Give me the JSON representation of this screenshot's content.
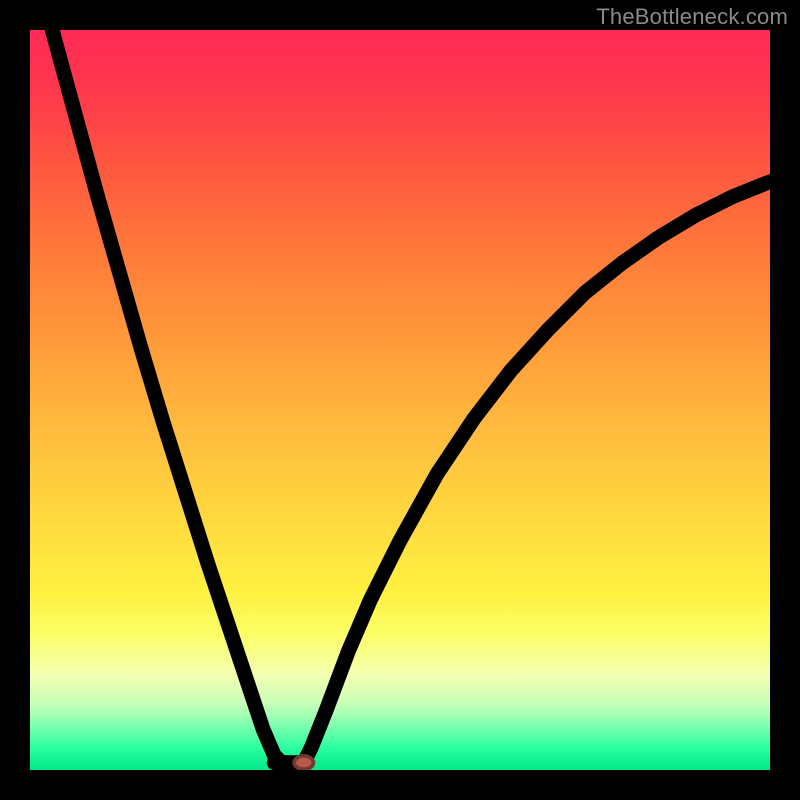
{
  "watermark": "TheBottleneck.com",
  "chart_data": {
    "type": "line",
    "title": "",
    "xlabel": "",
    "ylabel": "",
    "xlim": [
      0,
      100
    ],
    "ylim": [
      0,
      100
    ],
    "background_gradient": {
      "top": "#ff2a55",
      "bottom": "#00e78a",
      "stops": [
        {
          "pct": 0,
          "color": "#ff2a55"
        },
        {
          "pct": 30,
          "color": "#ff7a3a"
        },
        {
          "pct": 66,
          "color": "#ffd93f"
        },
        {
          "pct": 87,
          "color": "#f4ffb0"
        },
        {
          "pct": 100,
          "color": "#00e78a"
        }
      ]
    },
    "series": [
      {
        "name": "left-branch",
        "x": [
          3,
          6,
          9,
          12,
          15,
          18,
          21,
          24,
          27,
          30,
          31.5,
          33,
          34,
          35
        ],
        "y": [
          100,
          89,
          78,
          67.5,
          57,
          47,
          37.5,
          28,
          19,
          10,
          5.5,
          2,
          1,
          1
        ]
      },
      {
        "name": "right-branch",
        "x": [
          37,
          38,
          40,
          43,
          46,
          50,
          55,
          60,
          65,
          70,
          75,
          80,
          85,
          90,
          95,
          100
        ],
        "y": [
          1,
          3,
          8,
          16,
          23,
          31,
          40,
          47.5,
          54,
          59.5,
          64.5,
          68.5,
          72,
          75,
          77.5,
          79.5
        ]
      },
      {
        "name": "flat-segment",
        "x": [
          33,
          37
        ],
        "y": [
          1,
          1
        ]
      }
    ],
    "marker": {
      "x": 37,
      "y": 1,
      "rx": 1.3,
      "ry": 0.9,
      "color": "#b85a4a"
    }
  }
}
